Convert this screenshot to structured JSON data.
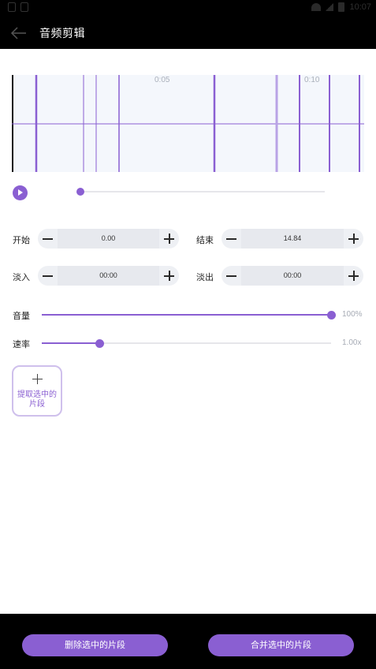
{
  "status_bar": {
    "time": "10:07"
  },
  "toolbar": {
    "back_icon": "arrow-left-icon",
    "title": "音频剪辑"
  },
  "waveform": {
    "time_labels": [
      "0:05",
      "0:10"
    ],
    "colors": {
      "background": "#f4f7fc",
      "line": "#8a5fd2",
      "highlight": "#b9a3e6"
    }
  },
  "player": {
    "play_icon": "play-icon",
    "progress": 0.0
  },
  "trim": {
    "start_label": "开始",
    "start_value": "0.00",
    "end_label": "结束",
    "end_value": "14.84",
    "fade_in_label": "淡入",
    "fade_in_value": "00:00",
    "fade_out_label": "淡出",
    "fade_out_value": "00:00"
  },
  "volume": {
    "label": "音量",
    "value_text": "100%",
    "fraction": 1.0
  },
  "speed": {
    "label": "速率",
    "value_text": "1.00x",
    "fraction": 0.2
  },
  "extract": {
    "icon": "plus-icon",
    "label": "提取选中的片段"
  },
  "bottom": {
    "delete_label": "删除选中的片段",
    "merge_label": "合并选中的片段"
  },
  "accent_color": "#8a5fd2"
}
